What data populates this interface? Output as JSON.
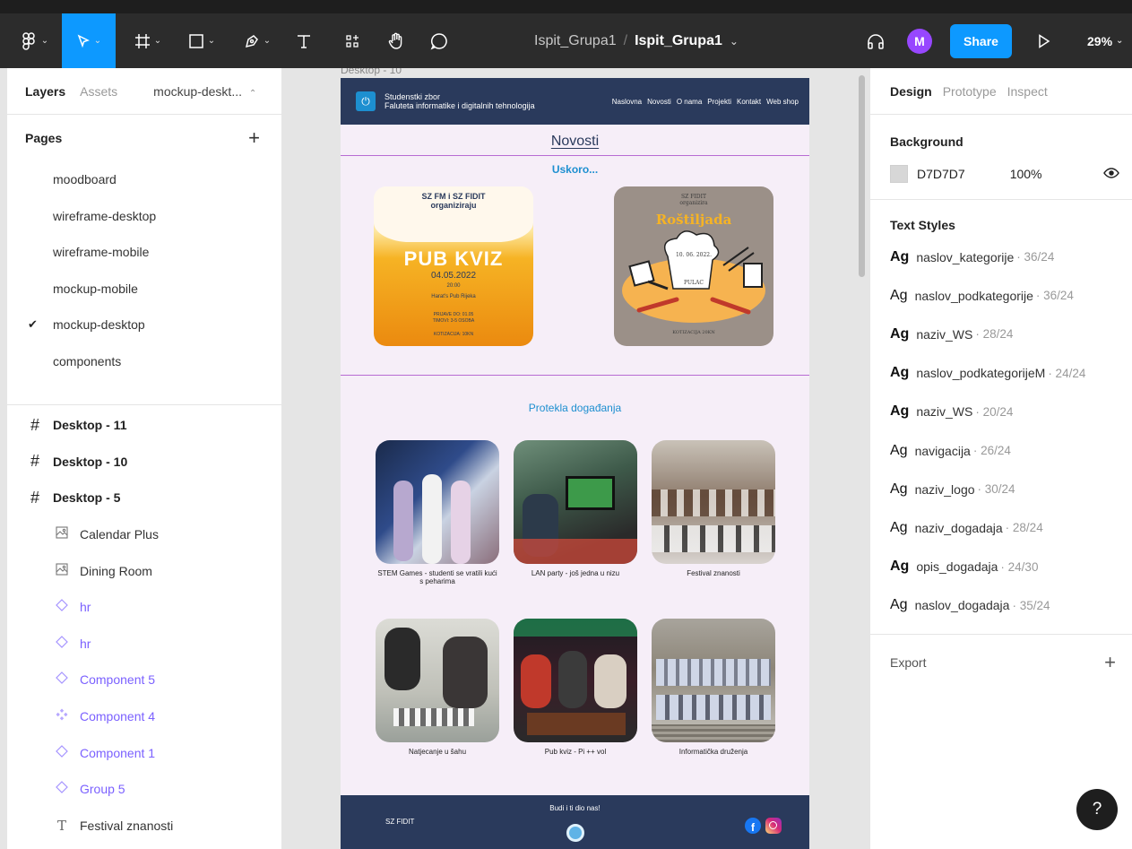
{
  "toolbar": {
    "file_project": "Ispit_Grupa1",
    "file_separator": "/",
    "file_name": "Ispit_Grupa1",
    "avatar_initial": "M",
    "share_label": "Share",
    "zoom_label": "29%",
    "accent_color": "#0d99ff",
    "icons": [
      "figma-menu-icon",
      "move-tool-icon",
      "frame-tool-icon",
      "shape-tool-icon",
      "pen-tool-icon",
      "text-tool-icon",
      "resources-icon",
      "hand-tool-icon",
      "comment-icon",
      "headphones-icon",
      "play-icon"
    ]
  },
  "left_panel": {
    "tabs": [
      "Layers",
      "Assets"
    ],
    "current_page_select": "mockup-deskt...",
    "pages_title": "Pages",
    "pages": [
      "moodboard",
      "wireframe-desktop",
      "wireframe-mobile",
      "mockup-mobile",
      "mockup-desktop",
      "components"
    ],
    "selected_page": "mockup-desktop",
    "layers": [
      {
        "label": "Desktop - 11",
        "icon": "frame-icon",
        "level": "top"
      },
      {
        "label": "Desktop - 10",
        "icon": "frame-icon",
        "level": "top"
      },
      {
        "label": "Desktop - 5",
        "icon": "frame-icon",
        "level": "top"
      },
      {
        "label": "Calendar Plus",
        "icon": "image-icon",
        "level": "child"
      },
      {
        "label": "Dining Room",
        "icon": "image-icon",
        "level": "child"
      },
      {
        "label": "hr",
        "icon": "instance-icon",
        "level": "child"
      },
      {
        "label": "hr",
        "icon": "instance-icon",
        "level": "child"
      },
      {
        "label": "Component 5",
        "icon": "instance-icon",
        "level": "child"
      },
      {
        "label": "Component 4",
        "icon": "component-icon",
        "level": "child"
      },
      {
        "label": "Component 1",
        "icon": "instance-icon",
        "level": "child"
      },
      {
        "label": "Group 5",
        "icon": "instance-icon",
        "level": "child"
      },
      {
        "label": "Festival znanosti",
        "icon": "text-layer-icon",
        "level": "child"
      }
    ]
  },
  "canvas": {
    "frame_label": "Desktop - 10",
    "site": {
      "brand_line1": "Studenstki zbor",
      "brand_line2": "Faluteta informatike i digitalnih tehnologija",
      "nav_links": [
        "Naslovna",
        "Novosti",
        "O nama",
        "Projekti",
        "Kontakt",
        "Web shop"
      ],
      "page_heading": "Novosti",
      "soon_title": "Uskoro...",
      "poster_pub": {
        "top_line1": "SZ FM i SZ FIDIT",
        "top_line2": "organiziraju",
        "title": "PUB KVIZ",
        "date": "04.05.2022",
        "time": "20:00",
        "venue": "Harat's Pub Rijeka",
        "signup": "PRIJAVE DO: 01.05",
        "teams": "TIMOVI: 3-5 OSOBA",
        "fee": "KOTIZACIJA: 10KN"
      },
      "poster_grill": {
        "top_line1": "SZ FIDIT",
        "top_line2": "organizira",
        "title": "Roštiljada",
        "date": "10. 06. 2022.",
        "place": "PULAC",
        "fee": "KOTIZACIJA 20KN"
      },
      "past_title": "Protekla događanja",
      "events": [
        {
          "caption": "STEM Games - studenti se vratili kući  s peharima",
          "photo": "trophy-photo"
        },
        {
          "caption": "LAN party - još jedna u nizu",
          "photo": "gaming-photo"
        },
        {
          "caption": "Festival znanosti",
          "photo": "audience-photo"
        },
        {
          "caption": "Natjecanje u šahu",
          "photo": "chess-photo"
        },
        {
          "caption": "Pub kviz - Pi ++ vol",
          "photo": "pub-photo"
        },
        {
          "caption": "Informatička druženja",
          "photo": "group-photo"
        }
      ],
      "footer_brand": "SZ FIDIT",
      "footer_join": "Budi i ti dio nas!",
      "brand_color": "#2a3a5c",
      "link_color": "#1d8fd0"
    }
  },
  "right_panel": {
    "tabs": [
      "Design",
      "Prototype",
      "Inspect"
    ],
    "background_title": "Background",
    "background_hex": "D7D7D7",
    "background_opacity": "100%",
    "text_styles_title": "Text Styles",
    "text_styles": [
      {
        "ag": "Ag",
        "name": "naslov_kategorije",
        "meta": "· 36/24",
        "bold": true
      },
      {
        "ag": "Ag",
        "name": "naslov_podkategorije",
        "meta": "· 36/24",
        "bold": false
      },
      {
        "ag": "Ag",
        "name": "naziv_WS",
        "meta": "· 28/24",
        "bold": true
      },
      {
        "ag": "Ag",
        "name": "naslov_podkategorijeM",
        "meta": "· 24/24",
        "bold": true
      },
      {
        "ag": "Ag",
        "name": "naziv_WS",
        "meta": "· 20/24",
        "bold": true
      },
      {
        "ag": "Ag",
        "name": "navigacija",
        "meta": "· 26/24",
        "bold": false
      },
      {
        "ag": "Ag",
        "name": "naziv_logo",
        "meta": "· 30/24",
        "bold": false
      },
      {
        "ag": "Ag",
        "name": "naziv_dogadaja",
        "meta": "· 28/24",
        "bold": false
      },
      {
        "ag": "Ag",
        "name": "opis_dogadaja",
        "meta": "· 24/30",
        "bold": true
      },
      {
        "ag": "Ag",
        "name": "naslov_dogadaja",
        "meta": "· 35/24",
        "bold": false
      }
    ],
    "export_label": "Export",
    "help_label": "?"
  }
}
